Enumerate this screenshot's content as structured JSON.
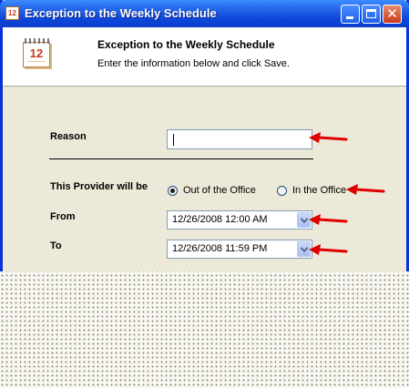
{
  "window": {
    "title": "Exception to the Weekly Schedule",
    "app_icon_text": "12"
  },
  "header": {
    "title": "Exception to the Weekly Schedule",
    "subtitle": "Enter the information below and click Save.",
    "calendar_icon_text": "12"
  },
  "form": {
    "reason_label": "Reason",
    "reason_value": "",
    "status_label": "This Provider will be",
    "status_options": [
      {
        "label": "Out of the Office",
        "selected": true
      },
      {
        "label": "In the Office",
        "selected": false
      }
    ],
    "from_label": "From",
    "from_value": "12/26/2008 12:00 AM",
    "to_label": "To",
    "to_value": "12/26/2008 11:59 PM"
  },
  "annotations": {
    "arrow_color": "#e00000"
  },
  "colors": {
    "titlebar": "#0a44d8",
    "dialog_bg": "#ece9d8",
    "header_bg": "#ffffff",
    "input_border": "#7f9db9",
    "close_button": "#c53a1a"
  }
}
